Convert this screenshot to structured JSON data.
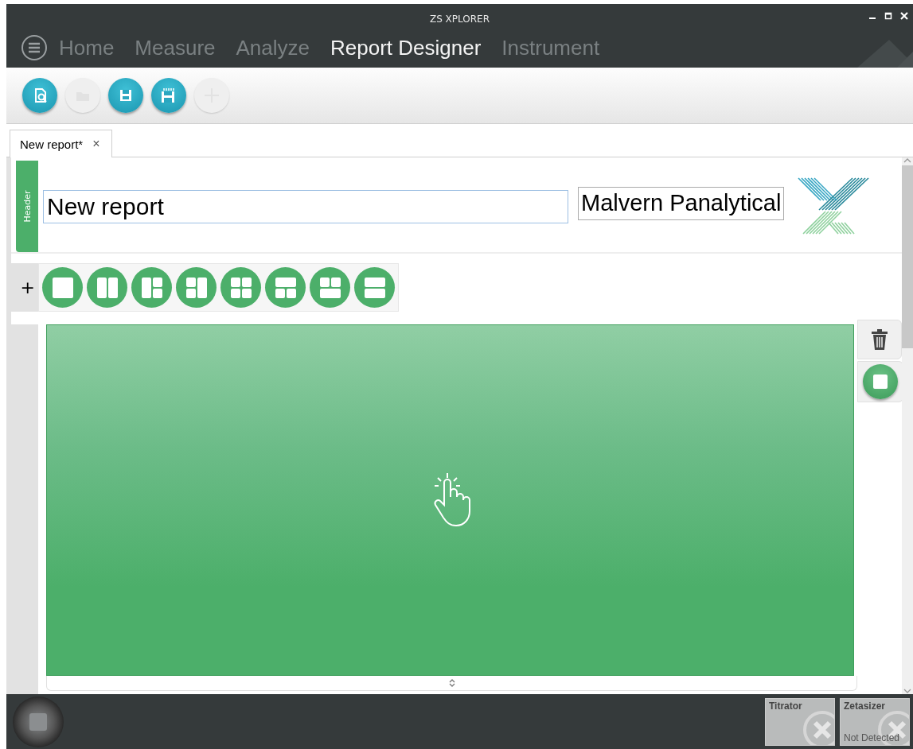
{
  "window": {
    "title": "ZS XPLORER"
  },
  "nav_tabs": [
    {
      "label": "Home",
      "selected": false
    },
    {
      "label": "Measure",
      "selected": false
    },
    {
      "label": "Analyze",
      "selected": false
    },
    {
      "label": "Report Designer",
      "selected": true
    },
    {
      "label": "Instrument",
      "selected": false
    }
  ],
  "toolbar": [
    {
      "kind": "preview",
      "disabled": false
    },
    {
      "kind": "open",
      "disabled": true
    },
    {
      "kind": "save",
      "disabled": false
    },
    {
      "kind": "save-all",
      "disabled": false
    },
    {
      "kind": "add",
      "disabled": true
    }
  ],
  "document_tabs": [
    {
      "label": "New report*",
      "selected": true,
      "close": "×"
    }
  ],
  "header": {
    "label": "Header",
    "title": "New report",
    "company": "Malvern Panalytical"
  },
  "layout_add": "+",
  "layouts": [
    {
      "kind": "single"
    },
    {
      "kind": "two-columns"
    },
    {
      "kind": "left-split-right"
    },
    {
      "kind": "split-left-right"
    },
    {
      "kind": "grid"
    },
    {
      "kind": "top-split"
    },
    {
      "kind": "split-top"
    },
    {
      "kind": "two-rows"
    }
  ],
  "instruments": [
    {
      "name": "Titrator"
    },
    {
      "name": "Zetasizer",
      "status": "Not Detected"
    }
  ]
}
